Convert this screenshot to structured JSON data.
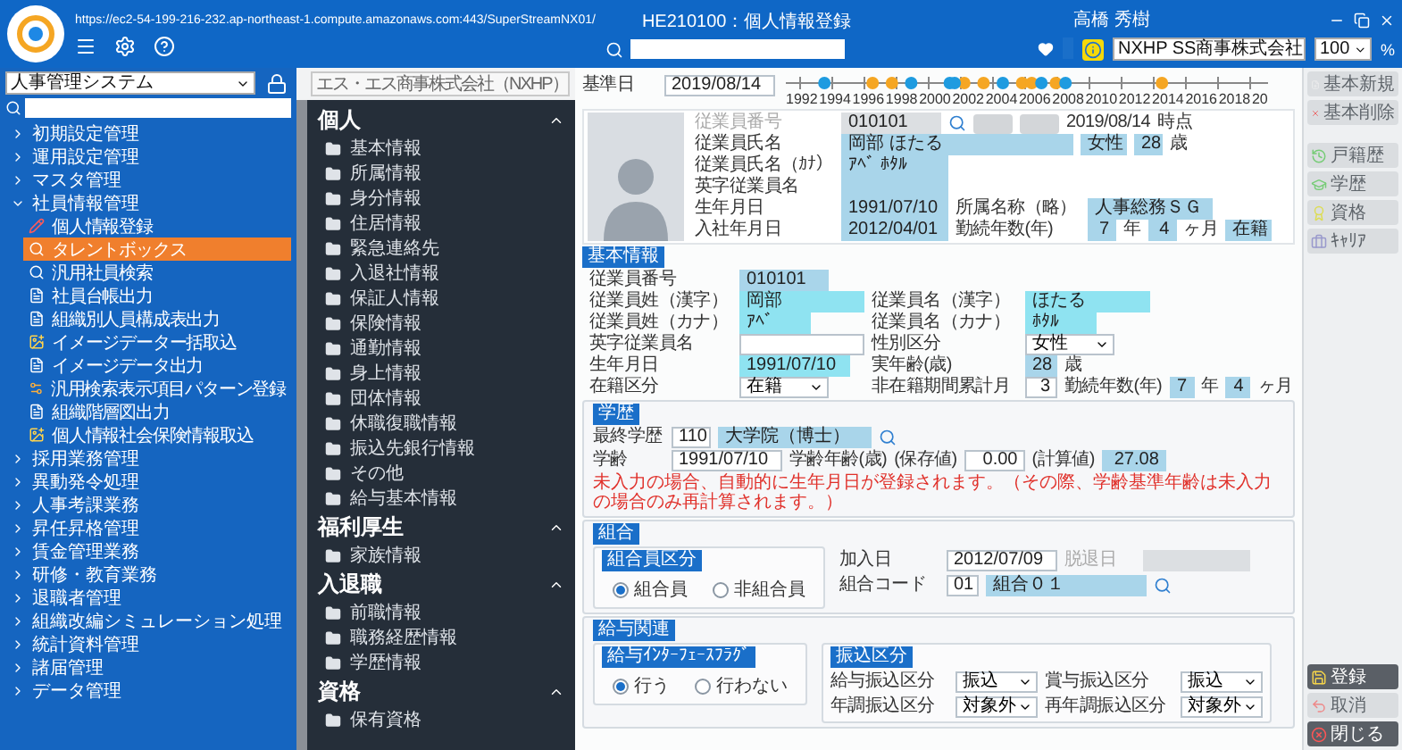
{
  "topbar": {
    "url": "https://ec2-54-199-216-232.ap-northeast-1.compute.amazonaws.com:443/SuperStreamNX01/",
    "screen_title": "HE210100：個人情報登録",
    "user": "高橋 秀樹",
    "company": "NXHP SS商事株式会社",
    "zoom": "100",
    "zoom_unit": "%"
  },
  "sidebar": {
    "system": "人事管理システム",
    "items": [
      {
        "label": "初期設定管理",
        "expanded": false
      },
      {
        "label": "運用設定管理",
        "expanded": false
      },
      {
        "label": "マスタ管理",
        "expanded": false
      },
      {
        "label": "社員情報管理",
        "expanded": true,
        "children": [
          {
            "label": "個人情報登録",
            "kind": "edit",
            "selected": false
          },
          {
            "label": "タレントボックス",
            "kind": "search",
            "selected": true
          },
          {
            "label": "汎用社員検索",
            "kind": "search",
            "selected": false
          },
          {
            "label": "社員台帳出力",
            "kind": "document",
            "selected": false
          },
          {
            "label": "組織別人員構成表出力",
            "kind": "document",
            "selected": false
          },
          {
            "label": "イメージデーター括取込",
            "kind": "import",
            "selected": false
          },
          {
            "label": "イメージデータ出力",
            "kind": "document",
            "selected": false
          },
          {
            "label": "汎用検索表示項目パターン登録",
            "kind": "pattern",
            "selected": false
          },
          {
            "label": "組織階層図出力",
            "kind": "document",
            "selected": false
          },
          {
            "label": "個人情報社会保険情報取込",
            "kind": "import",
            "selected": false
          }
        ]
      },
      {
        "label": "採用業務管理",
        "expanded": false
      },
      {
        "label": "異動発令処理",
        "expanded": false
      },
      {
        "label": "人事考課業務",
        "expanded": false
      },
      {
        "label": "昇任昇格管理",
        "expanded": false
      },
      {
        "label": "賃金管理業務",
        "expanded": false
      },
      {
        "label": "研修・教育業務",
        "expanded": false
      },
      {
        "label": "退職者管理",
        "expanded": false
      },
      {
        "label": "組織改編シミュレーション処理",
        "expanded": false
      },
      {
        "label": "統計資料管理",
        "expanded": false
      },
      {
        "label": "諸届管理",
        "expanded": false
      },
      {
        "label": "データ管理",
        "expanded": false
      }
    ]
  },
  "nav": {
    "company": "エス・エス商事株式会社（NXHP）",
    "sections": [
      {
        "title": "個人",
        "expanded": true,
        "items": [
          "基本情報",
          "所属情報",
          "身分情報",
          "住居情報",
          "緊急連絡先",
          "入退社情報",
          "保証人情報",
          "保険情報",
          "通勤情報",
          "身上情報",
          "団体情報",
          "休職復職情報",
          "振込先銀行情報",
          "その他",
          "給与基本情報"
        ]
      },
      {
        "title": "福利厚生",
        "expanded": true,
        "items": [
          "家族情報"
        ]
      },
      {
        "title": "入退職",
        "expanded": true,
        "items": [
          "前職情報",
          "職務経歴情報",
          "学歴情報"
        ]
      },
      {
        "title": "資格",
        "expanded": true,
        "items": [
          "保有資格"
        ]
      }
    ]
  },
  "form": {
    "base_date": {
      "label": "基準日",
      "value": "2019/08/14"
    },
    "timeline": {
      "years": [
        "1992",
        "1994",
        "1996",
        "1998",
        "2000",
        "2002",
        "2004",
        "2006",
        "2008",
        "2010",
        "2012",
        "2014",
        "2016",
        "2018",
        "20"
      ]
    },
    "profile": {
      "number_label": "従業員番号",
      "number": "010101",
      "as_of": "2019/08/14",
      "as_of_suffix": "時点",
      "name_label": "従業員氏名",
      "name": "岡部 ほたる",
      "gender": "女性",
      "age": "28",
      "age_unit": "歳",
      "kana_label": "従業員氏名（ｶﾅ）",
      "kana": "ｱﾍﾞ ﾎﾀﾙ",
      "english_label": "英字従業員名",
      "birth_label": "生年月日",
      "birth": "1991/07/10",
      "dept_label": "所属名称（略）",
      "dept": "人事総務ＳＧ",
      "join_label": "入社年月日",
      "join": "2012/04/01",
      "tenure_label": "勤続年数(年)",
      "years": "7",
      "years_unit": "年",
      "months": "4",
      "months_unit": "ヶ月",
      "status": "在籍"
    },
    "basic": {
      "title": "基本情報",
      "number_label": "従業員番号",
      "number": "010101",
      "last_kanji_label": "従業員姓（漢字）",
      "last_kanji": "岡部",
      "first_kanji_label": "従業員名（漢字）",
      "first_kanji": "ほたる",
      "last_kana_label": "従業員姓（カナ）",
      "last_kana": "ｱﾍﾞ",
      "first_kana_label": "従業員名（カナ）",
      "first_kana": "ﾎﾀﾙ",
      "english_label": "英字従業員名",
      "gender_label": "性別区分",
      "gender": "女性",
      "birth_label": "生年月日",
      "birth": "1991/07/10",
      "age_label": "実年齢(歳)",
      "age": "28",
      "age_unit": "歳",
      "status_label": "在籍区分",
      "status": "在籍",
      "absence_label": "非在籍期間累計月",
      "absence": "3",
      "tenure_label": "勤続年数(年)",
      "years": "7",
      "years_unit": "年",
      "months": "4",
      "months_unit": "ヶ月"
    },
    "education": {
      "title": "学歴",
      "final_label": "最終学歴",
      "final_code": "110",
      "final_name": "大学院（博士）",
      "school_label": "学齢",
      "school_date": "1991/07/10",
      "school_age_label": "学齢年齢(歳)",
      "saved_label": "(保存値)",
      "saved": "0.00",
      "calc_label": "(計算値)",
      "calc": "27.08",
      "note": "未入力の場合、自動的に生年月日が登録されます。（その際、学齢基準年齢は未入力の場合のみ再計算されます。）"
    },
    "union": {
      "title": "組合",
      "type_title": "組合員区分",
      "options": [
        {
          "label": "組合員",
          "selected": true
        },
        {
          "label": "非組合員",
          "selected": false
        }
      ],
      "join_label": "加入日",
      "join": "2012/07/09",
      "leave_label": "脱退日",
      "code_label": "組合コード",
      "code": "01",
      "code_name": "組合０１"
    },
    "payroll": {
      "title": "給与関連",
      "flag_title": "給与ｲﾝﾀｰﾌｪｰｽﾌﾗｸﾞ",
      "options": [
        {
          "label": "行う",
          "selected": true
        },
        {
          "label": "行わない",
          "selected": false
        }
      ],
      "transfer_title": "振込区分",
      "transfers": [
        {
          "label": "給与振込区分",
          "value": "振込"
        },
        {
          "label": "賞与振込区分",
          "value": "振込"
        },
        {
          "label": "年調振込区分",
          "value": "対象外"
        },
        {
          "label": "再年調振込区分",
          "value": "対象外"
        }
      ]
    }
  },
  "actions": {
    "groups": [
      [
        {
          "label": "基本新規",
          "kind": "new",
          "disabled": true
        },
        {
          "label": "基本削除",
          "kind": "delete",
          "disabled": true
        }
      ],
      [
        {
          "label": "戸籍歴",
          "kind": "history",
          "disabled": true
        },
        {
          "label": "学歴",
          "kind": "education",
          "disabled": true
        },
        {
          "label": "資格",
          "kind": "license",
          "disabled": true
        },
        {
          "label": "ｷｬﾘｱ",
          "kind": "career",
          "disabled": true
        }
      ]
    ],
    "bottom": [
      {
        "label": "登録",
        "kind": "save",
        "disabled": false
      },
      {
        "label": "取消",
        "kind": "cancel",
        "disabled": true
      },
      {
        "label": "閉じる",
        "kind": "close",
        "disabled": false
      }
    ]
  }
}
